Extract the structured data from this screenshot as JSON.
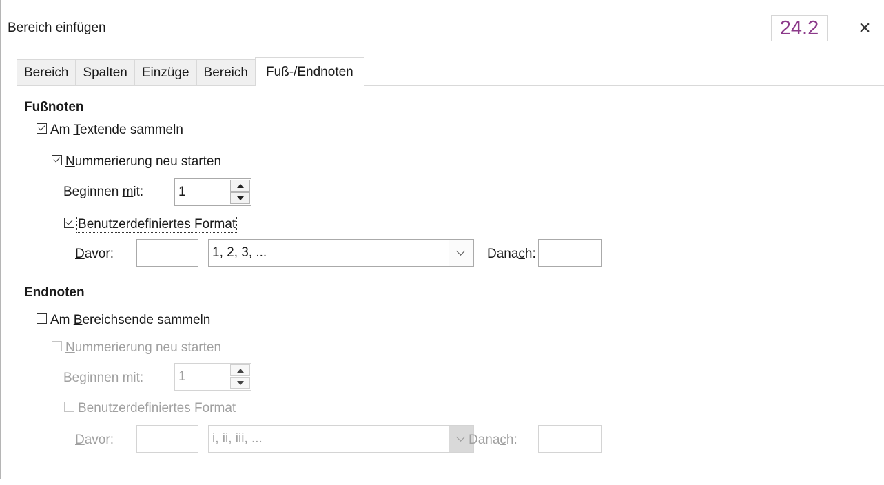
{
  "window": {
    "title": "Bereich einfügen",
    "version": "24.2",
    "close_glyph": "×"
  },
  "tabs": [
    {
      "label": "Bereich",
      "active": false
    },
    {
      "label": "Spalten",
      "active": false
    },
    {
      "label": "Einzüge",
      "active": false
    },
    {
      "label": "Bereich",
      "active": false
    },
    {
      "label": "Fuß-/Endnoten",
      "active": true
    }
  ],
  "footnotes": {
    "heading": "Fußnoten",
    "collect": {
      "pre": "Am ",
      "key": "T",
      "post": "extende sammeln",
      "checked": true
    },
    "restart": {
      "pre": "",
      "key": "N",
      "post": "ummerierung neu starten",
      "checked": true
    },
    "start_label": {
      "pre": "Beginnen ",
      "key": "m",
      "post": "it:"
    },
    "start_value": "1",
    "custom": {
      "pre": "",
      "key": "B",
      "post": "enutzerdefiniertes Format",
      "checked": true
    },
    "before_label": {
      "pre": "",
      "key": "D",
      "post": "avor:"
    },
    "before_value": "",
    "format_value": "1, 2, 3, ...",
    "after_label": {
      "pre": "Dana",
      "key": "c",
      "post": "h:"
    },
    "after_value": ""
  },
  "endnotes": {
    "heading": "Endnoten",
    "collect": {
      "pre": "Am ",
      "key": "B",
      "post": "ereichsende sammeln",
      "checked": false
    },
    "restart": {
      "pre": "",
      "key": "N",
      "post": "ummerierung neu starten",
      "checked": false
    },
    "start_label": {
      "pre": "Be",
      "key": "g",
      "post": "innen mit:"
    },
    "start_value": "1",
    "custom": {
      "pre": "Benutzer",
      "key": "d",
      "post": "efiniertes Format",
      "checked": false
    },
    "before_label": {
      "pre": "",
      "key": "D",
      "post": "avor:"
    },
    "before_value": "",
    "format_value": "i, ii, iii, ...",
    "after_label": {
      "pre": "Dana",
      "key": "c",
      "post": "h:"
    },
    "after_value": ""
  },
  "colors": {
    "version_text": "#8c3a8a",
    "disabled_text": "#a0a0a0"
  }
}
